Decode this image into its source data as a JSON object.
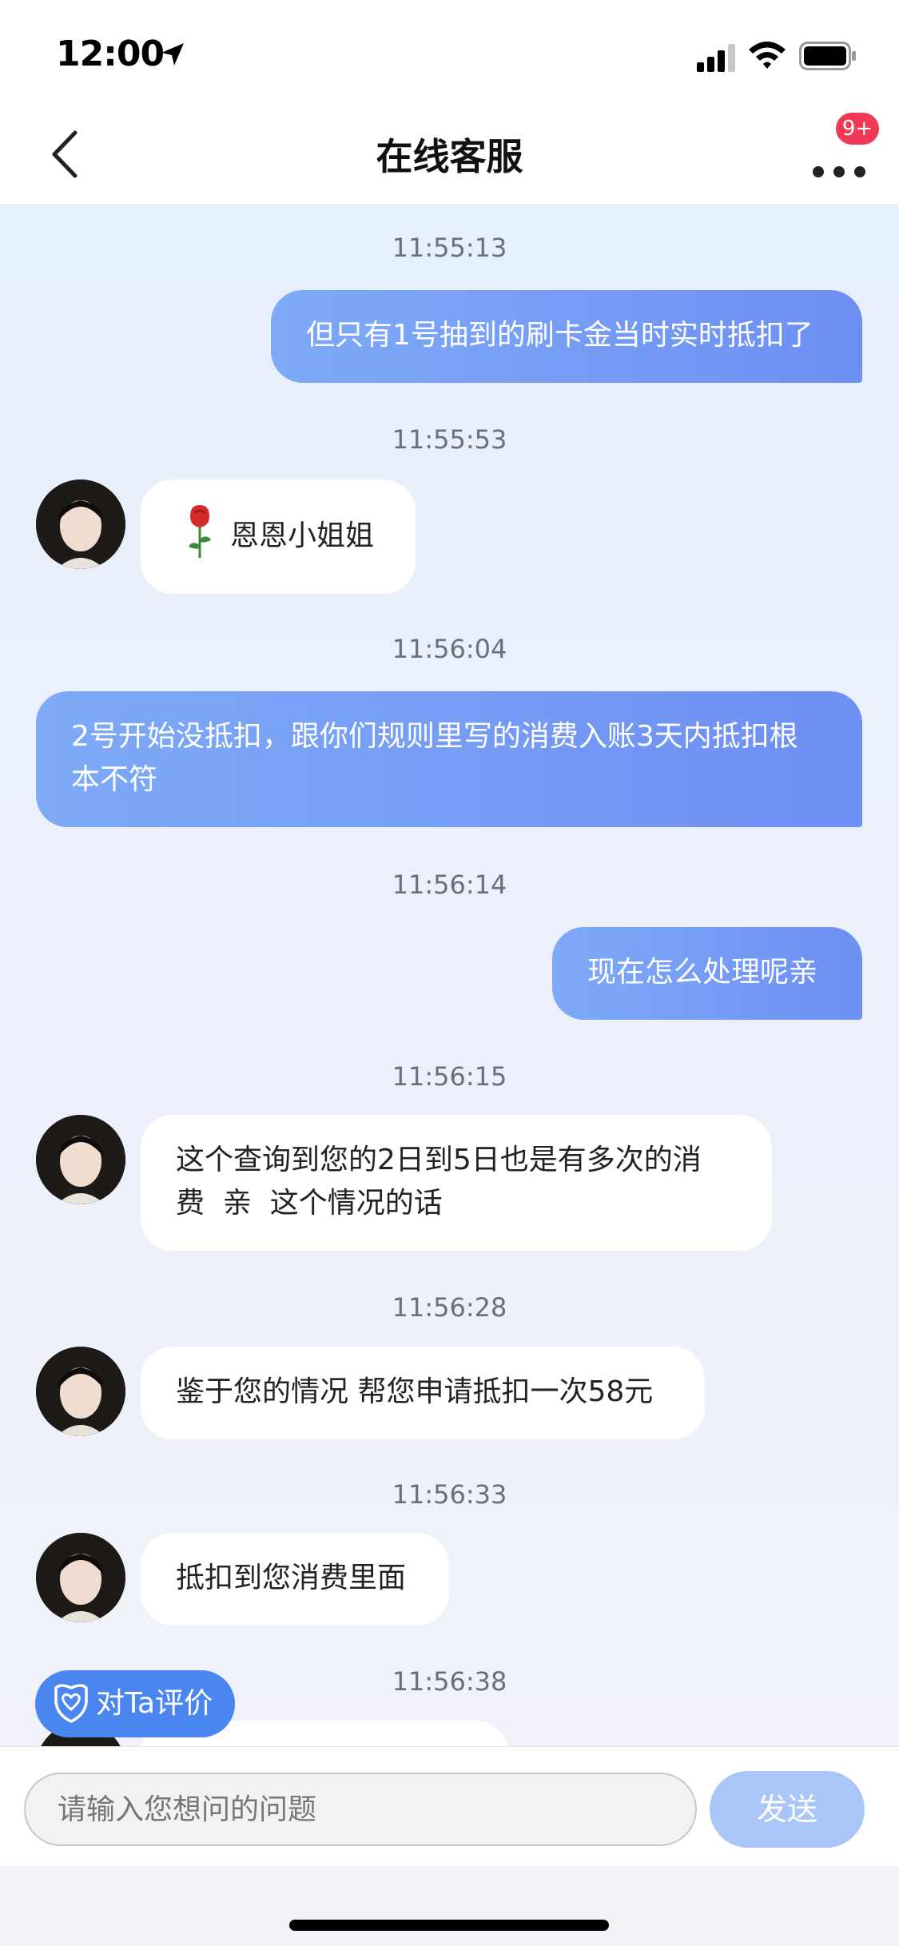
{
  "status_bar": {
    "time": "12:00"
  },
  "header": {
    "title": "在线客服",
    "badge": "9+"
  },
  "messages": [
    {
      "time": "11:55:13",
      "side": "right",
      "text": "但只有1号抽到的刷卡金当时实时抵扣了"
    },
    {
      "time": "11:55:53",
      "side": "left",
      "text": "恩恩小姐姐",
      "icon": "rose"
    },
    {
      "time": "11:56:04",
      "side": "right",
      "line1": "2号开始没抵扣，跟你们规则里写的消费入账3天内抵扣根",
      "line2": "本不符"
    },
    {
      "time": "11:56:14",
      "side": "right",
      "text": "现在怎么处理呢亲"
    },
    {
      "time": "11:56:15",
      "side": "left",
      "line1": "这个查询到您的2日到5日也是有多次的消",
      "line2": "费  亲  这个情况的话"
    },
    {
      "time": "11:56:28",
      "side": "left",
      "text": "鉴于您的情况 帮您申请抵扣一次58元"
    },
    {
      "time": "11:56:33",
      "side": "left",
      "text": "抵扣到您消费里面"
    },
    {
      "time": "11:56:38"
    }
  ],
  "rate_button": {
    "label": "对Ta评价"
  },
  "input": {
    "placeholder": "请输入您想问的问题"
  },
  "send_button": {
    "label": "发送"
  },
  "colors": {
    "accent": "#4b86f0",
    "bubble_gradient_start": "#7eaaf7",
    "bubble_gradient_end": "#6e8ff3",
    "badge": "#f03a55"
  }
}
